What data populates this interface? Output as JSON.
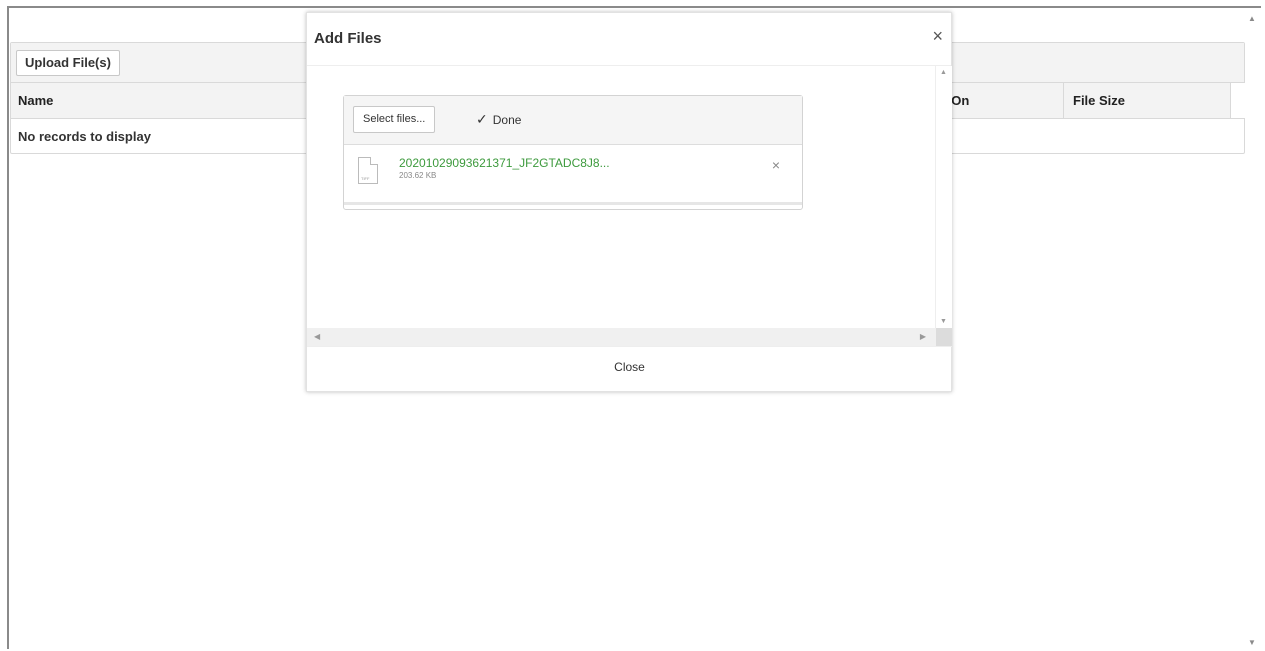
{
  "toolbar": {
    "upload_label": "Upload File(s)"
  },
  "grid": {
    "columns": {
      "name": "Name",
      "uploaded_on": "l On",
      "file_size": "File Size"
    },
    "empty_text": "No records to display"
  },
  "modal": {
    "title": "Add Files",
    "close_symbol": "×",
    "select_label": "Select files...",
    "done_label": "Done",
    "done_icon": "check-icon",
    "file": {
      "name": "20201029093621371_JF2GTADC8J8...",
      "size": "203.62 KB",
      "ext": "TIFF",
      "remove_symbol": "×"
    },
    "footer_close": "Close"
  },
  "colors": {
    "file_name": "#3d9a3d",
    "toolbar_bg": "#f3f3f3"
  }
}
